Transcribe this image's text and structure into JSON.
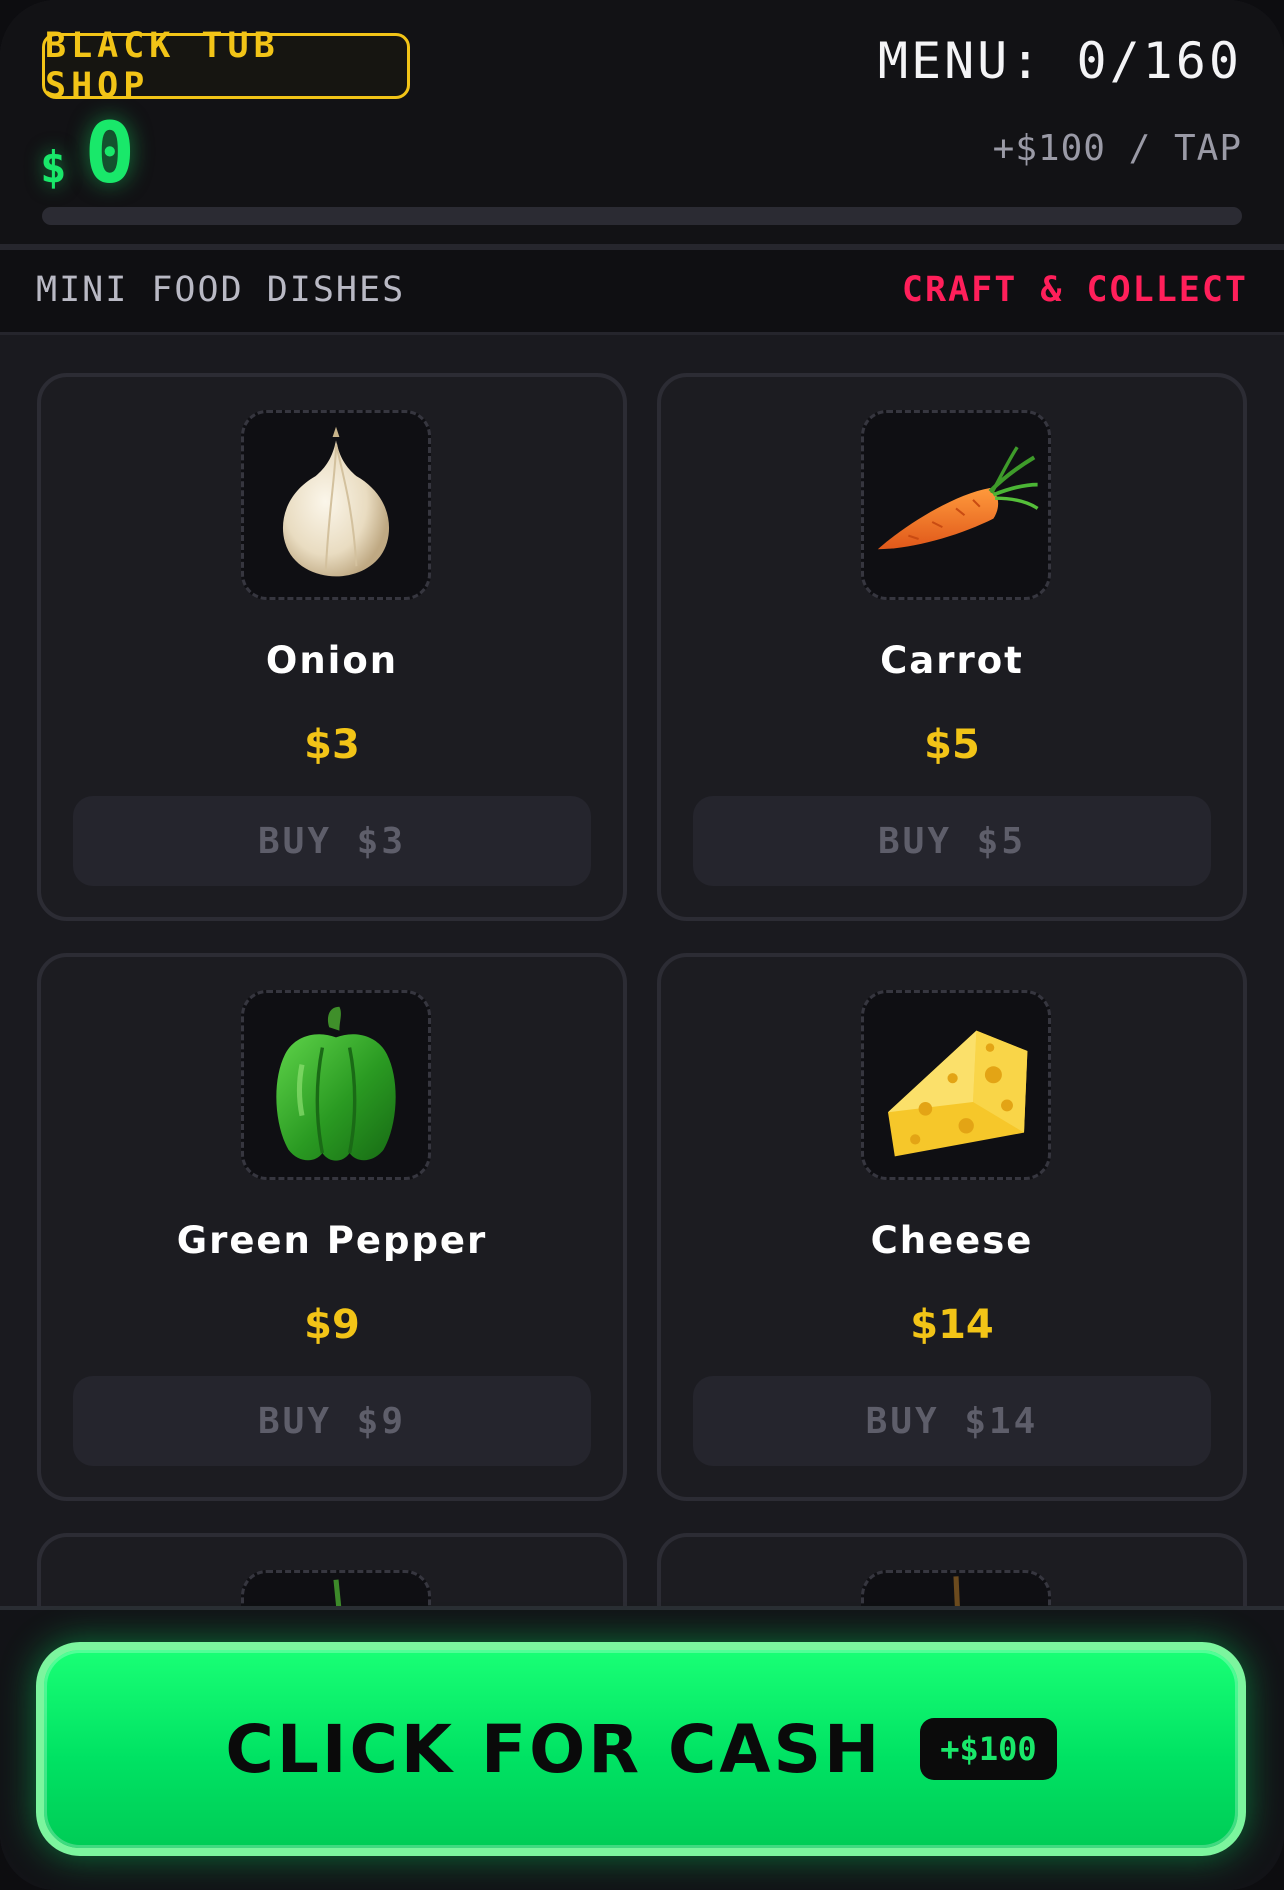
{
  "header": {
    "shop_name": "BLACK TUB SHOP",
    "menu_label": "MENU: 0/160",
    "currency_symbol": "$",
    "cash": "0",
    "tap_rate": "+$100 / TAP",
    "progress_fraction": 0
  },
  "subheader": {
    "left": "MINI FOOD DISHES",
    "right": "CRAFT & COLLECT"
  },
  "items": [
    {
      "name": "Onion",
      "price": "$3",
      "buy_label": "BUY $3",
      "icon": "onion-icon"
    },
    {
      "name": "Carrot",
      "price": "$5",
      "buy_label": "BUY $5",
      "icon": "carrot-icon"
    },
    {
      "name": "Green Pepper",
      "price": "$9",
      "buy_label": "BUY $9",
      "icon": "green-pepper-icon"
    },
    {
      "name": "Cheese",
      "price": "$14",
      "buy_label": "BUY $14",
      "icon": "cheese-icon"
    }
  ],
  "partial_items": [
    {
      "icon": "tomato-icon"
    },
    {
      "icon": "apple-icon"
    }
  ],
  "cash_button": {
    "label": "CLICK FOR CASH",
    "pill": "+$100"
  },
  "colors": {
    "accent_green": "#19e86a",
    "accent_yellow": "#f2c417",
    "accent_pink": "#ff1f5a",
    "background": "#1a1a1f"
  }
}
